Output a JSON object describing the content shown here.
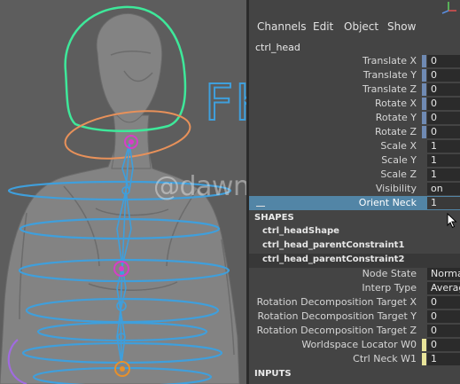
{
  "viewport": {
    "watermark": "@dawn_arc",
    "label": "FK",
    "colors": {
      "background": "#5d5d5d",
      "body": "#808080",
      "control_blue": "#3f9fdc",
      "head_green": "#3ee89a",
      "neck_orange": "#e8915a",
      "joint_magenta": "#d63ec8",
      "joint_orange": "#e8902a",
      "hand_purple": "#a06be0"
    }
  },
  "channel_box": {
    "menu": [
      "Channels",
      "Edit",
      "Object",
      "Show"
    ],
    "node_name": "ctrl_head",
    "attributes": [
      {
        "label": "Translate X",
        "value": "0"
      },
      {
        "label": "Translate Y",
        "value": "0"
      },
      {
        "label": "Translate Z",
        "value": "0"
      },
      {
        "label": "Rotate X",
        "value": "0"
      },
      {
        "label": "Rotate Y",
        "value": "0"
      },
      {
        "label": "Rotate Z",
        "value": "0"
      },
      {
        "label": "Scale X",
        "value": "1"
      },
      {
        "label": "Scale Y",
        "value": "1"
      },
      {
        "label": "Scale Z",
        "value": "1"
      },
      {
        "label": "Visibility",
        "value": "on"
      },
      {
        "label": "Orient Neck",
        "value": "1"
      }
    ],
    "shapes_header": "SHAPES",
    "shapes": [
      "ctrl_headShape",
      "ctrl_head_parentConstraint1",
      "ctrl_head_parentConstraint2"
    ],
    "constraint_attributes": [
      {
        "label": "Node State",
        "value": "Normal"
      },
      {
        "label": "Interp Type",
        "value": "Average"
      },
      {
        "label": "Rotation Decomposition Target X",
        "value": "0"
      },
      {
        "label": "Rotation Decomposition Target Y",
        "value": "0"
      },
      {
        "label": "Rotation Decomposition Target Z",
        "value": "0"
      },
      {
        "label": "Worldspace Locator W0",
        "value": "0"
      },
      {
        "label": "Ctrl Neck W1",
        "value": "1"
      }
    ],
    "inputs_header": "INPUTS",
    "colors": {
      "selection": "#5285a6",
      "keyable_swatch": "#6f8ab3",
      "weight_swatch": "#e8e49a",
      "field": "#2b2b2b"
    }
  }
}
